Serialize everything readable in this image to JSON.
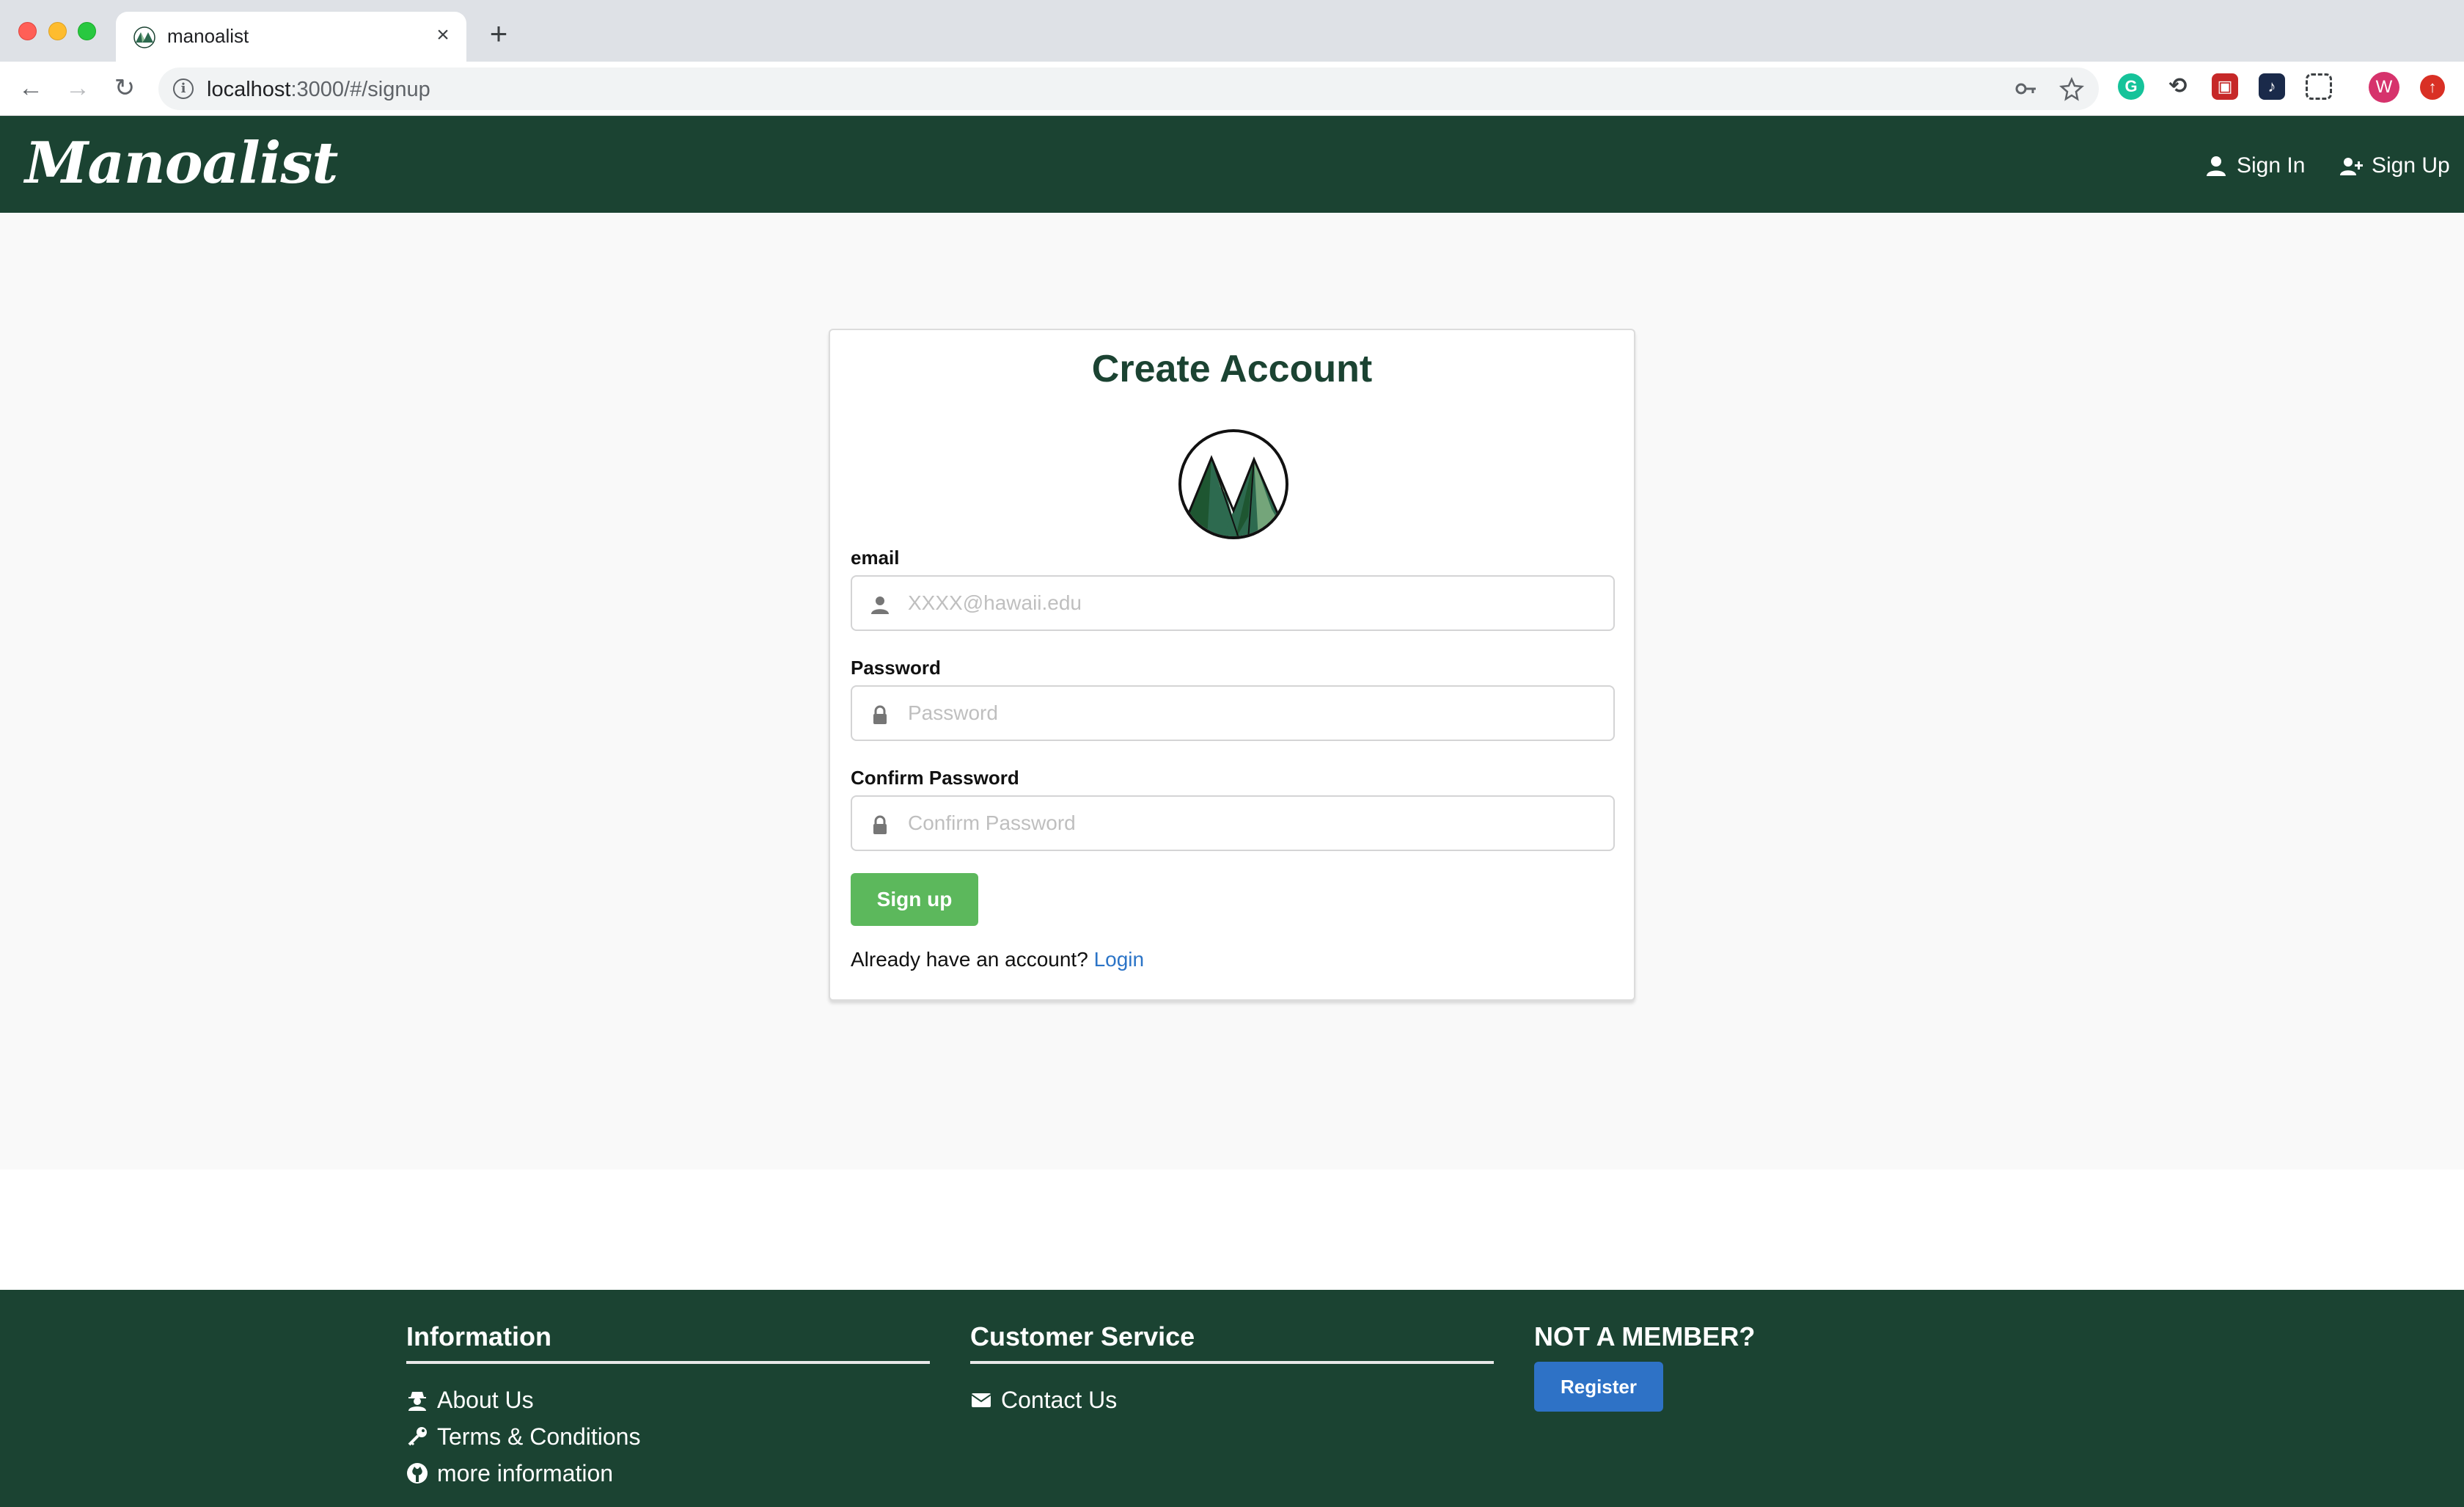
{
  "browser": {
    "tab_title": "manoalist",
    "tab_close": "×",
    "new_tab": "+",
    "url_host": "localhost",
    "url_path": ":3000/#/signup",
    "avatar_letter": "W"
  },
  "navbar": {
    "brand": "Manoalist",
    "signin_label": "Sign In",
    "signup_label": "Sign Up",
    "background": "#1b4332"
  },
  "signup_form": {
    "title": "Create Account",
    "email_label": "email",
    "email_placeholder": "XXXX@hawaii.edu",
    "password_label": "Password",
    "password_placeholder": "Password",
    "confirm_label": "Confirm Password",
    "confirm_placeholder": "Confirm Password",
    "submit_label": "Sign up",
    "already_text": "Already have an account?",
    "login_link": "Login",
    "submit_color": "#5cb85c"
  },
  "footer": {
    "information": {
      "heading": "Information",
      "links": [
        "About Us",
        "Terms & Conditions",
        "more information"
      ]
    },
    "customer_service": {
      "heading": "Customer Service",
      "links": [
        "Contact Us"
      ]
    },
    "member": {
      "heading": "NOT A MEMBER?",
      "register_label": "Register",
      "register_color": "#2e72c6"
    }
  }
}
